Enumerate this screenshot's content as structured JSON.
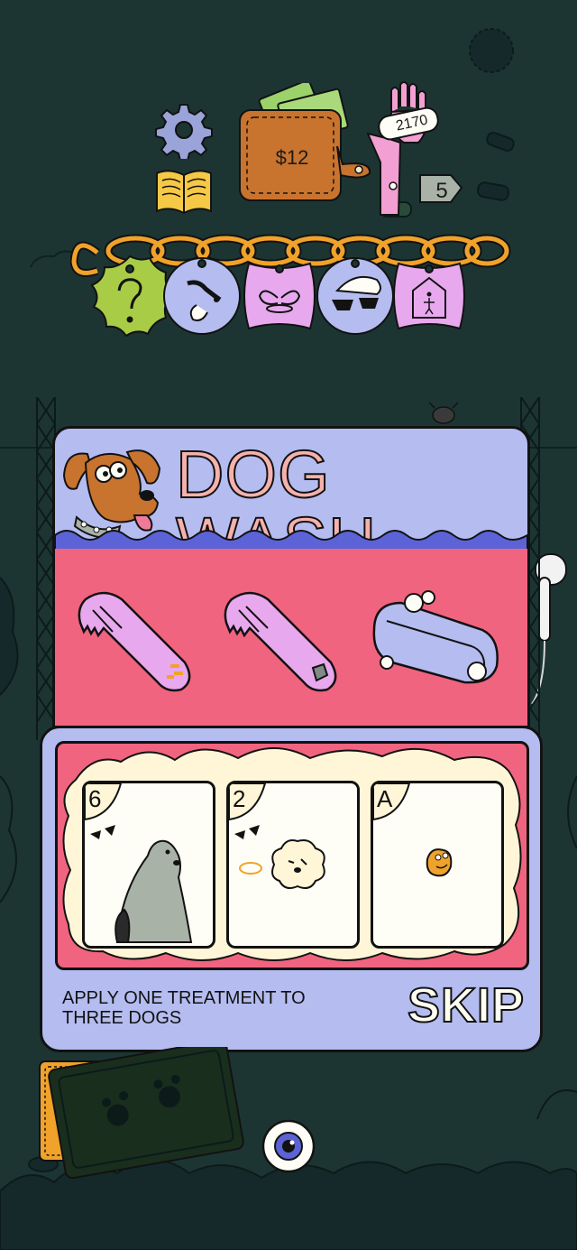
{
  "hud": {
    "wallet_amount": "$12",
    "hand_score": "2170",
    "deck_count": "5",
    "settings_icon": "gear-icon",
    "rulebook_icon": "book-icon"
  },
  "charms": [
    {
      "icon": "question-mark-icon",
      "color": "#a9cc47"
    },
    {
      "icon": "dog-face-icon",
      "color": "#b4bcf0"
    },
    {
      "icon": "angel-wings-icon",
      "color": "#e8a8ee"
    },
    {
      "icon": "cool-sunglasses-icon",
      "color": "#b4bcf0"
    },
    {
      "icon": "dog-house-icon",
      "color": "#e8a8ee"
    }
  ],
  "shop": {
    "title": "DOG WASH",
    "mascot_icon": "dog-mascot-icon",
    "treatments": [
      {
        "icon": "comb-icon",
        "detail": "orange-sparkle"
      },
      {
        "icon": "comb-icon",
        "detail": "gray-rock"
      },
      {
        "icon": "soap-bar-icon",
        "detail": "bubbles"
      }
    ]
  },
  "dogs": [
    {
      "rank": "6",
      "icon": "gray-tall-dog-icon",
      "badge": "sunglasses"
    },
    {
      "rank": "2",
      "icon": "white-fluffy-dog-icon",
      "badge": "sunglasses-halo"
    },
    {
      "rank": "A",
      "icon": "tiny-orange-dog-icon",
      "badge": ""
    }
  ],
  "instruction": "APPLY ONE TREATMENT TO\nTHREE DOGS",
  "skip_label": "SKIP",
  "colors": {
    "background": "#1c3533",
    "panel_blue": "#b4bcf0",
    "panel_pink": "#f06480",
    "title_pink": "#f6b1ad",
    "cream": "#fffef6"
  }
}
